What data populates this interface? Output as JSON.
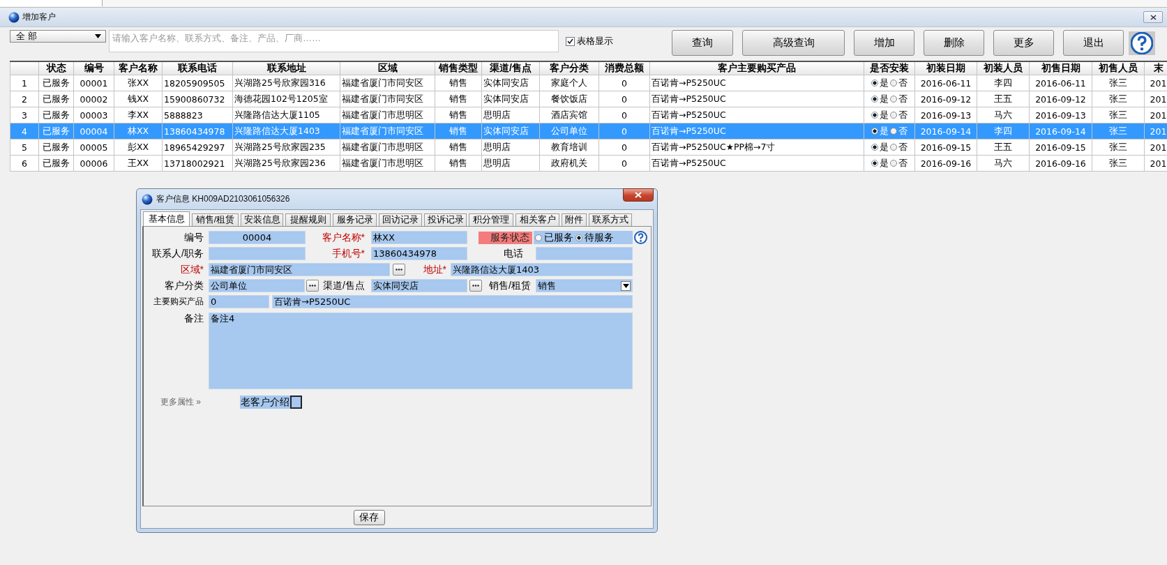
{
  "window": {
    "title": "增加客户"
  },
  "toolbar": {
    "filter": {
      "value": "全 部"
    },
    "search": {
      "placeholder": "请输入客户名称、联系方式、备注、产品、厂商……"
    },
    "grid_view": {
      "label": "表格显示",
      "checked": true
    },
    "buttons": [
      "查询",
      "高级查询",
      "增加",
      "删除",
      "更多",
      "退出"
    ]
  },
  "table": {
    "columns": [
      "状态",
      "编号",
      "客户名称",
      "联系电话",
      "联系地址",
      "区域",
      "销售类型",
      "渠道/售点",
      "客户分类",
      "消费总额",
      "客户主要购买产品",
      "是否安装",
      "初装日期",
      "初装人员",
      "初售日期",
      "初售人员",
      "末"
    ],
    "rows": [
      {
        "selected": false,
        "number": "1",
        "cells": [
          "已服务",
          "00001",
          "张XX",
          "18205909505",
          "兴湖路25号欣家园316",
          "福建省厦门市同安区",
          "销售",
          "实体同安店",
          "家庭个人",
          "0",
          "百诺肯→P5250UC"
        ],
        "installed": true,
        "install_options": [
          "是",
          "否"
        ],
        "after": [
          "2016-06-11",
          "李四",
          "2016-06-11",
          "张三",
          "201"
        ]
      },
      {
        "selected": false,
        "number": "2",
        "cells": [
          "已服务",
          "00002",
          "钱XX",
          "15900860732",
          "海德花园102号1205室",
          "福建省厦门市同安区",
          "销售",
          "实体同安店",
          "餐饮饭店",
          "0",
          "百诺肯→P5250UC"
        ],
        "installed": true,
        "install_options": [
          "是",
          "否"
        ],
        "after": [
          "2016-09-12",
          "王五",
          "2016-09-12",
          "张三",
          "201"
        ]
      },
      {
        "selected": false,
        "number": "3",
        "cells": [
          "已服务",
          "00003",
          "李XX",
          "5888823",
          "兴隆路信达大厦1105",
          "福建省厦门市思明区",
          "销售",
          "思明店",
          "酒店宾馆",
          "0",
          "百诺肯→P5250UC"
        ],
        "installed": true,
        "install_options": [
          "是",
          "否"
        ],
        "after": [
          "2016-09-13",
          "马六",
          "2016-09-13",
          "张三",
          "201"
        ]
      },
      {
        "selected": true,
        "number": "4",
        "cells": [
          "已服务",
          "00004",
          "林XX",
          "13860434978",
          "兴隆路信达大厦1403",
          "福建省厦门市同安区",
          "销售",
          "实体同安店",
          "公司单位",
          "0",
          "百诺肯→P5250UC"
        ],
        "installed": true,
        "install_options": [
          "是",
          "否"
        ],
        "after": [
          "2016-09-14",
          "李四",
          "2016-09-14",
          "张三",
          "201"
        ]
      },
      {
        "selected": false,
        "number": "5",
        "cells": [
          "已服务",
          "00005",
          "彭XX",
          "18965429297",
          "兴湖路25号欣家园235",
          "福建省厦门市思明区",
          "销售",
          "思明店",
          "教育培训",
          "0",
          "百诺肯→P5250UC★PP棉→7寸"
        ],
        "installed": true,
        "install_options": [
          "是",
          "否"
        ],
        "after": [
          "2016-09-15",
          "王五",
          "2016-09-15",
          "张三",
          "201"
        ]
      },
      {
        "selected": false,
        "number": "6",
        "cells": [
          "已服务",
          "00006",
          "王XX",
          "13718002921",
          "兴湖路25号欣家园236",
          "福建省厦门市思明区",
          "销售",
          "思明店",
          "政府机关",
          "0",
          "百诺肯→P5250UC"
        ],
        "installed": true,
        "install_options": [
          "是",
          "否"
        ],
        "after": [
          "2016-09-16",
          "马六",
          "2016-09-16",
          "张三",
          "201"
        ]
      }
    ]
  },
  "dialog": {
    "title": "客户信息 KH009AD2103061056326",
    "tabs": [
      {
        "label": "基本信息",
        "selected": true
      },
      {
        "label": "销售/租赁",
        "selected": false
      },
      {
        "label": "安装信息",
        "selected": false
      },
      {
        "label": "提醒规则",
        "selected": false
      },
      {
        "label": "服务记录",
        "selected": false
      },
      {
        "label": "回访记录",
        "selected": false
      },
      {
        "label": "投诉记录",
        "selected": false
      },
      {
        "label": "积分管理",
        "selected": false
      },
      {
        "label": "相关客户",
        "selected": false
      },
      {
        "label": "附件",
        "selected": false
      },
      {
        "label": "联系方式",
        "selected": false
      }
    ],
    "fields": {
      "number": {
        "label": "编号",
        "value": "00004",
        "required": false
      },
      "name": {
        "label": "客户名称*",
        "value": "林XX",
        "required": true
      },
      "service_status": {
        "label": "服务状态",
        "options": [
          {
            "label": "已服务",
            "selected": false
          },
          {
            "label": "待服务",
            "selected": true
          }
        ]
      },
      "contact": {
        "label": "联系人/职务",
        "required": false
      },
      "mobile": {
        "label": "手机号*",
        "value": "13860434978",
        "required": true
      },
      "phone": {
        "label": "电话",
        "required": false
      },
      "region": {
        "label": "区域*",
        "value": "福建省厦门市同安区",
        "required": true
      },
      "address": {
        "label": "地址*",
        "value": "兴隆路信达大厦1403",
        "required": true
      },
      "category": {
        "label": "客户分类",
        "value": "公司单位",
        "required": false
      },
      "channel": {
        "label": "渠道/售点",
        "value": "实体同安店",
        "required": false
      },
      "sale_type": {
        "label": "销售/租赁",
        "value": "销售",
        "required": false
      },
      "product": {
        "label": "主要购买产品",
        "code": "0",
        "value": "百诺肯→P5250UC",
        "required": false
      },
      "notes": {
        "label": "备注",
        "value": "备注4",
        "required": false
      }
    },
    "more_link": "更多属性 »",
    "referral": {
      "label": "老客户介绍",
      "checked": false
    },
    "save_button": "保存"
  }
}
